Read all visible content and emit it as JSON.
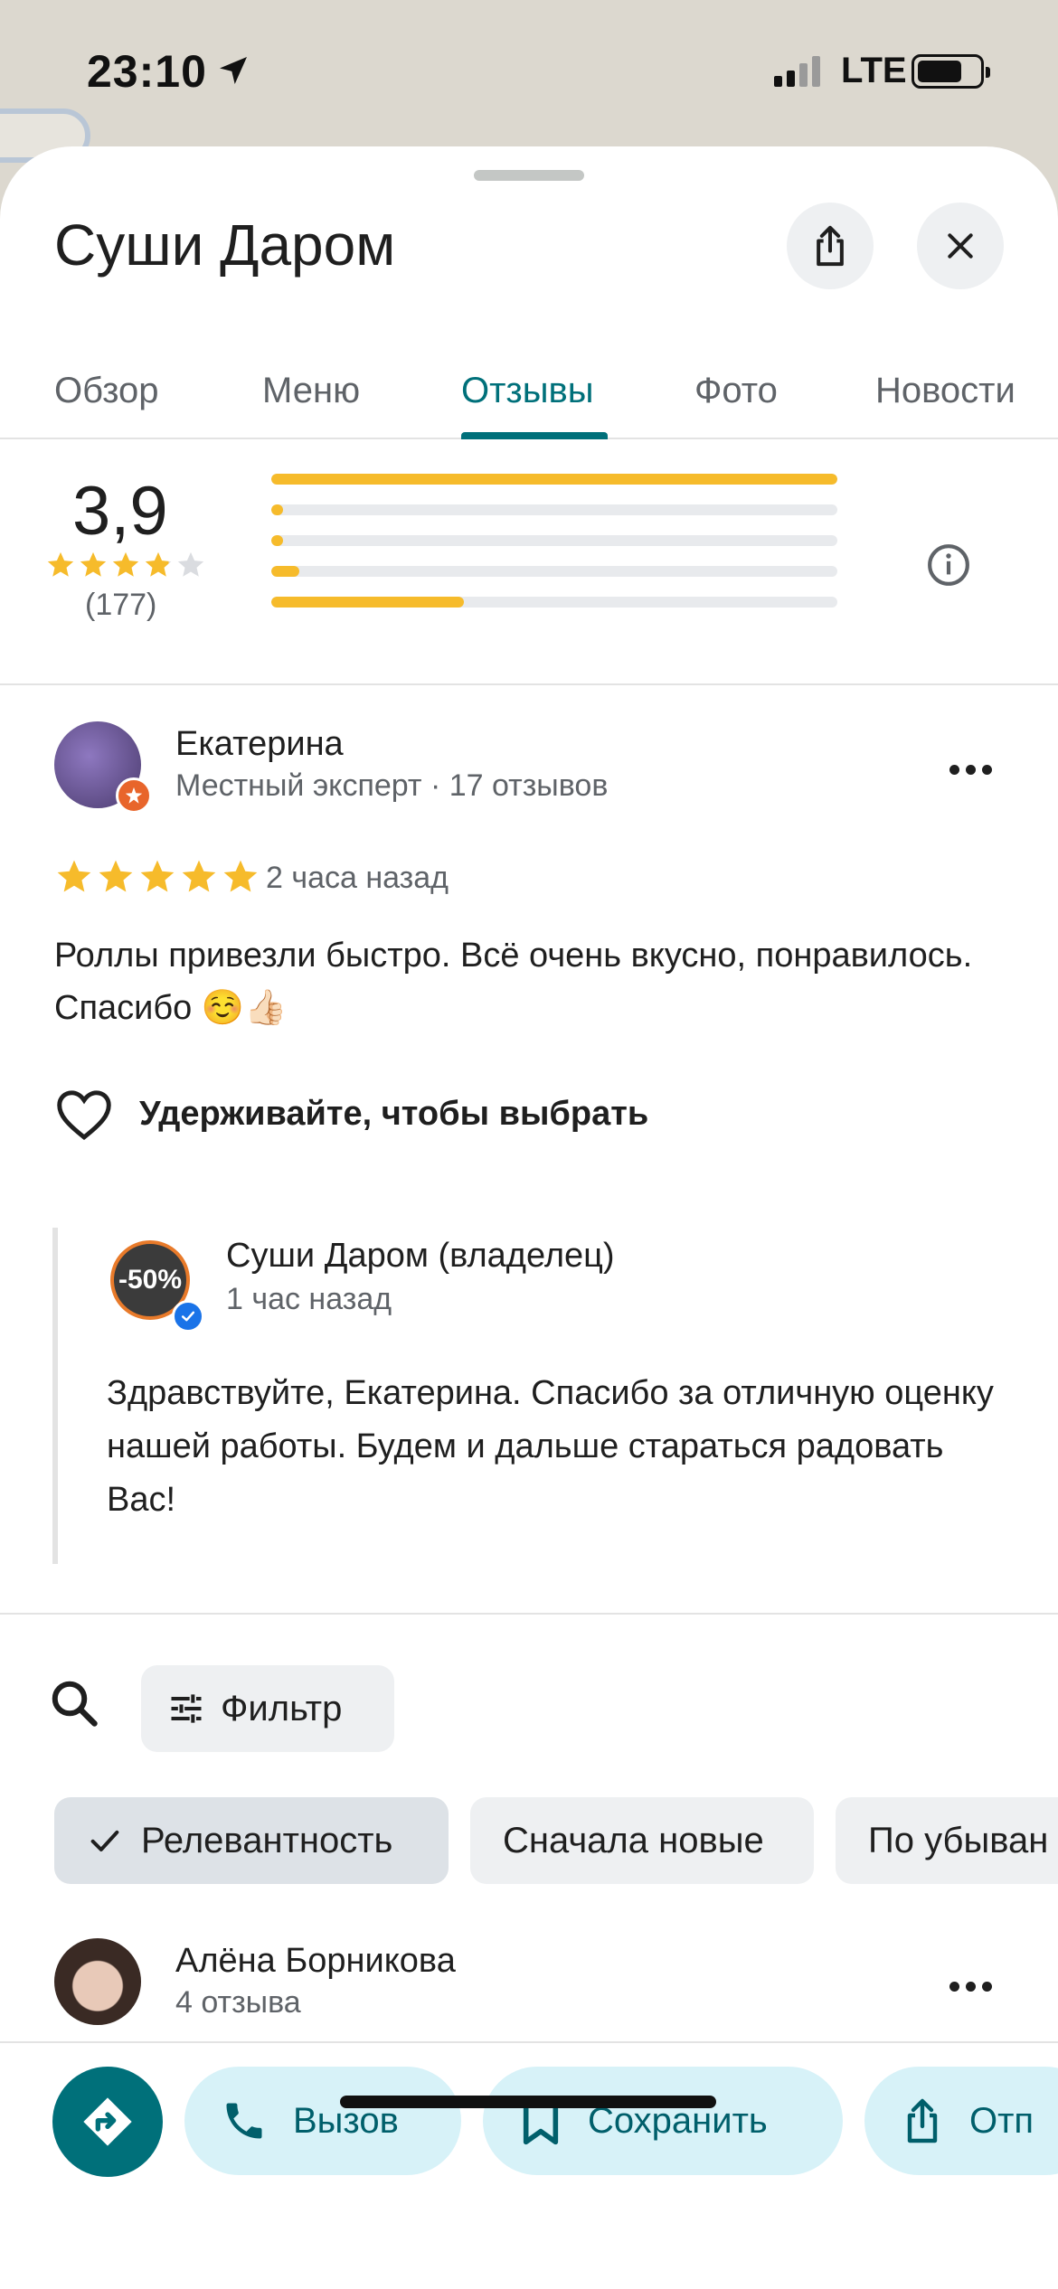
{
  "status_bar": {
    "time": "23:10",
    "network": "LTE",
    "battery_level": 0.65
  },
  "place": {
    "title": "Суши Даром"
  },
  "header": {
    "share_icon": "share-icon",
    "close_icon": "close-icon"
  },
  "tabs": [
    {
      "label": "Обзор",
      "active": false
    },
    {
      "label": "Меню",
      "active": false
    },
    {
      "label": "Отзывы",
      "active": true
    },
    {
      "label": "Фото",
      "active": false
    },
    {
      "label": "Новости",
      "active": false
    }
  ],
  "rating": {
    "value": "3,9",
    "stars": 3.9,
    "count": "(177)",
    "distribution": [
      {
        "stars": 5,
        "fraction": 1.0
      },
      {
        "stars": 4,
        "fraction": 0.02
      },
      {
        "stars": 3,
        "fraction": 0.01
      },
      {
        "stars": 2,
        "fraction": 0.05
      },
      {
        "stars": 1,
        "fraction": 0.34
      }
    ]
  },
  "review": {
    "author": "Екатерина",
    "meta": "Местный эксперт · 17 отзывов",
    "stars": 5,
    "time": "2 часа назад",
    "text": "Роллы привезли быстро. Всё очень вкусно, понравилось. Спасибо ☺️👍🏻",
    "like_label": "Удерживайте, чтобы выбрать"
  },
  "owner_reply": {
    "name": "Суши Даром (владелец)",
    "time": "1 час назад",
    "logo_text": "-50%",
    "text": "Здравствуйте, Екатерина. Спасибо за отличную оценку нашей работы. Будем и дальше стараться радовать Вас!"
  },
  "filters": {
    "filter_label": "Фильтр",
    "sort_chips": [
      {
        "label": "Релевантность",
        "selected": true
      },
      {
        "label": "Сначала новые",
        "selected": false
      },
      {
        "label": "По убыван",
        "selected": false
      }
    ]
  },
  "next_review": {
    "author": "Алёна Борникова",
    "meta": "4 отзыва"
  },
  "actions": {
    "call": "Вызов",
    "save": "Сохранить",
    "share": "Отп"
  },
  "colors": {
    "accent": "#00707a",
    "star": "#f6bb2b",
    "pill": "#d7f2f8"
  }
}
